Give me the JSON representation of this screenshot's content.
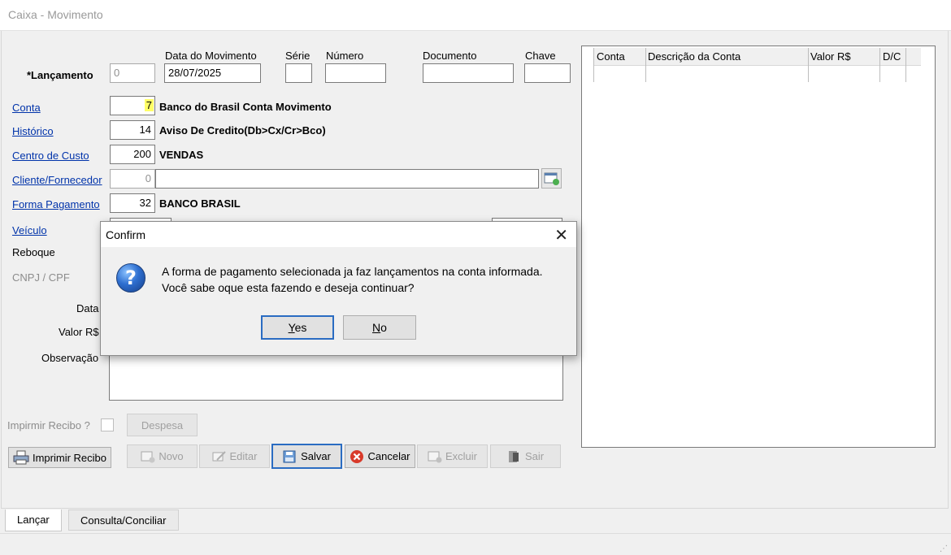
{
  "window": {
    "title": "Caixa - Movimento"
  },
  "form": {
    "header_labels": {
      "data_movimento": "Data do Movimento",
      "serie": "Série",
      "numero": "Número",
      "documento": "Documento",
      "chave": "Chave"
    },
    "lancamento": {
      "label": "*Lançamento",
      "value": "0"
    },
    "data_movimento_value": "28/07/2025",
    "conta": {
      "label": "Conta",
      "code": "7",
      "description": "Banco do Brasil Conta Movimento"
    },
    "historico": {
      "label": "Histórico",
      "code": "14",
      "description": "Aviso De Credito(Db>Cx/Cr>Bco)"
    },
    "centro_custo": {
      "label": "Centro de Custo",
      "code": "200",
      "description": "VENDAS"
    },
    "cliente_fornecedor": {
      "label": "Cliente/Fornecedor",
      "code": "0",
      "description": ""
    },
    "forma_pagamento": {
      "label": "Forma Pagamento",
      "code": "32",
      "description": "BANCO BRASIL"
    },
    "veiculo": {
      "label": "Veículo"
    },
    "reboque": {
      "label": "Reboque"
    },
    "cnpj_cpf": {
      "label": "CNPJ / CPF"
    },
    "data": {
      "label": "Data"
    },
    "valor": {
      "label": "Valor R$"
    },
    "observacao": {
      "label": "Observação"
    },
    "imprimir_recibo_q": {
      "label": "Impirmir Recibo ?"
    }
  },
  "grid": {
    "columns": [
      "Conta",
      "Descrição da Conta",
      "Valor R$",
      "D/C"
    ]
  },
  "buttons": {
    "despesa": "Despesa",
    "imprimir_recibo": "Imprimir Recibo",
    "novo": "Novo",
    "editar": "Editar",
    "salvar": "Salvar",
    "cancelar": "Cancelar",
    "excluir": "Excluir",
    "sair": "Sair"
  },
  "tabs": [
    "Lançar",
    "Consulta/Conciliar"
  ],
  "dialog": {
    "title": "Confirm",
    "close_symbol": "✕",
    "icon_glyph": "?",
    "line1": "A forma de pagamento selecionada ja faz lançamentos na conta informada.",
    "line2": "Você sabe oque esta fazendo e deseja continuar?",
    "yes_accel": "Y",
    "yes_rest": "es",
    "no_accel": "N",
    "no_rest": "o"
  },
  "icons": {
    "lookup": "lookup-window-icon",
    "printer": "printer-icon",
    "new": "new-document-icon",
    "edit": "edit-icon",
    "save": "floppy-icon",
    "cancel": "cancel-icon",
    "delete": "delete-icon",
    "exit": "exit-door-icon",
    "question": "question-icon"
  },
  "colors": {
    "link": "#0033aa",
    "highlight": "#ffff66",
    "focus": "#2a6cc2",
    "cancel_red": "#d83a2a"
  }
}
